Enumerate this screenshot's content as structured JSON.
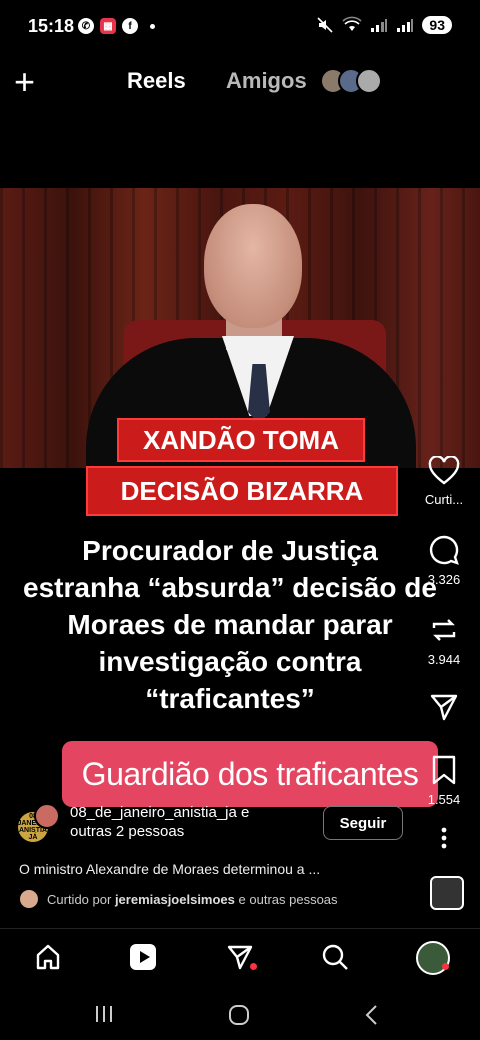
{
  "status_bar": {
    "time": "15:18",
    "battery": "93"
  },
  "top_nav": {
    "plus": "+",
    "tab_reels": "Reels",
    "tab_amigos": "Amigos"
  },
  "video": {
    "caption_line1": "XANDÃO TOMA",
    "caption_line2": "DECISÃO BIZARRA",
    "headline": "Procurador de Justiça estranha “absurda” decisão de Moraes de mandar parar investigação contra “traficantes”",
    "pink_banner": "Guardião dos traficantes"
  },
  "rail": {
    "like_label": "Curti...",
    "comment_count": "3.326",
    "repost_count": "3.944",
    "save_count": "1.554"
  },
  "author": {
    "avatar_text": "08 JANEIRO ANISTIA JÁ",
    "name": "08_de_janeiro_anistia_ja",
    "others": "e outras 2 pessoas",
    "line1": "08_de_janeiro_anistia_ja e",
    "line2": "outras 2 pessoas",
    "follow_label": "Seguir"
  },
  "caption": "O ministro Alexandre de Moraes determinou a ...",
  "liked_by": {
    "prefix": "Curtido por",
    "user": "jeremiasjoelsimoes",
    "suffix": "e outras pessoas"
  },
  "colors": {
    "accent_red": "#cc1b1b",
    "banner_pink": "#e44561",
    "notif_dot": "#ff3040"
  },
  "icons": [
    "plus-icon",
    "heart-icon",
    "comment-icon",
    "repost-icon",
    "share-icon",
    "bookmark-icon",
    "more-icon",
    "home-icon",
    "reels-icon",
    "send-icon",
    "search-icon",
    "profile-avatar"
  ]
}
